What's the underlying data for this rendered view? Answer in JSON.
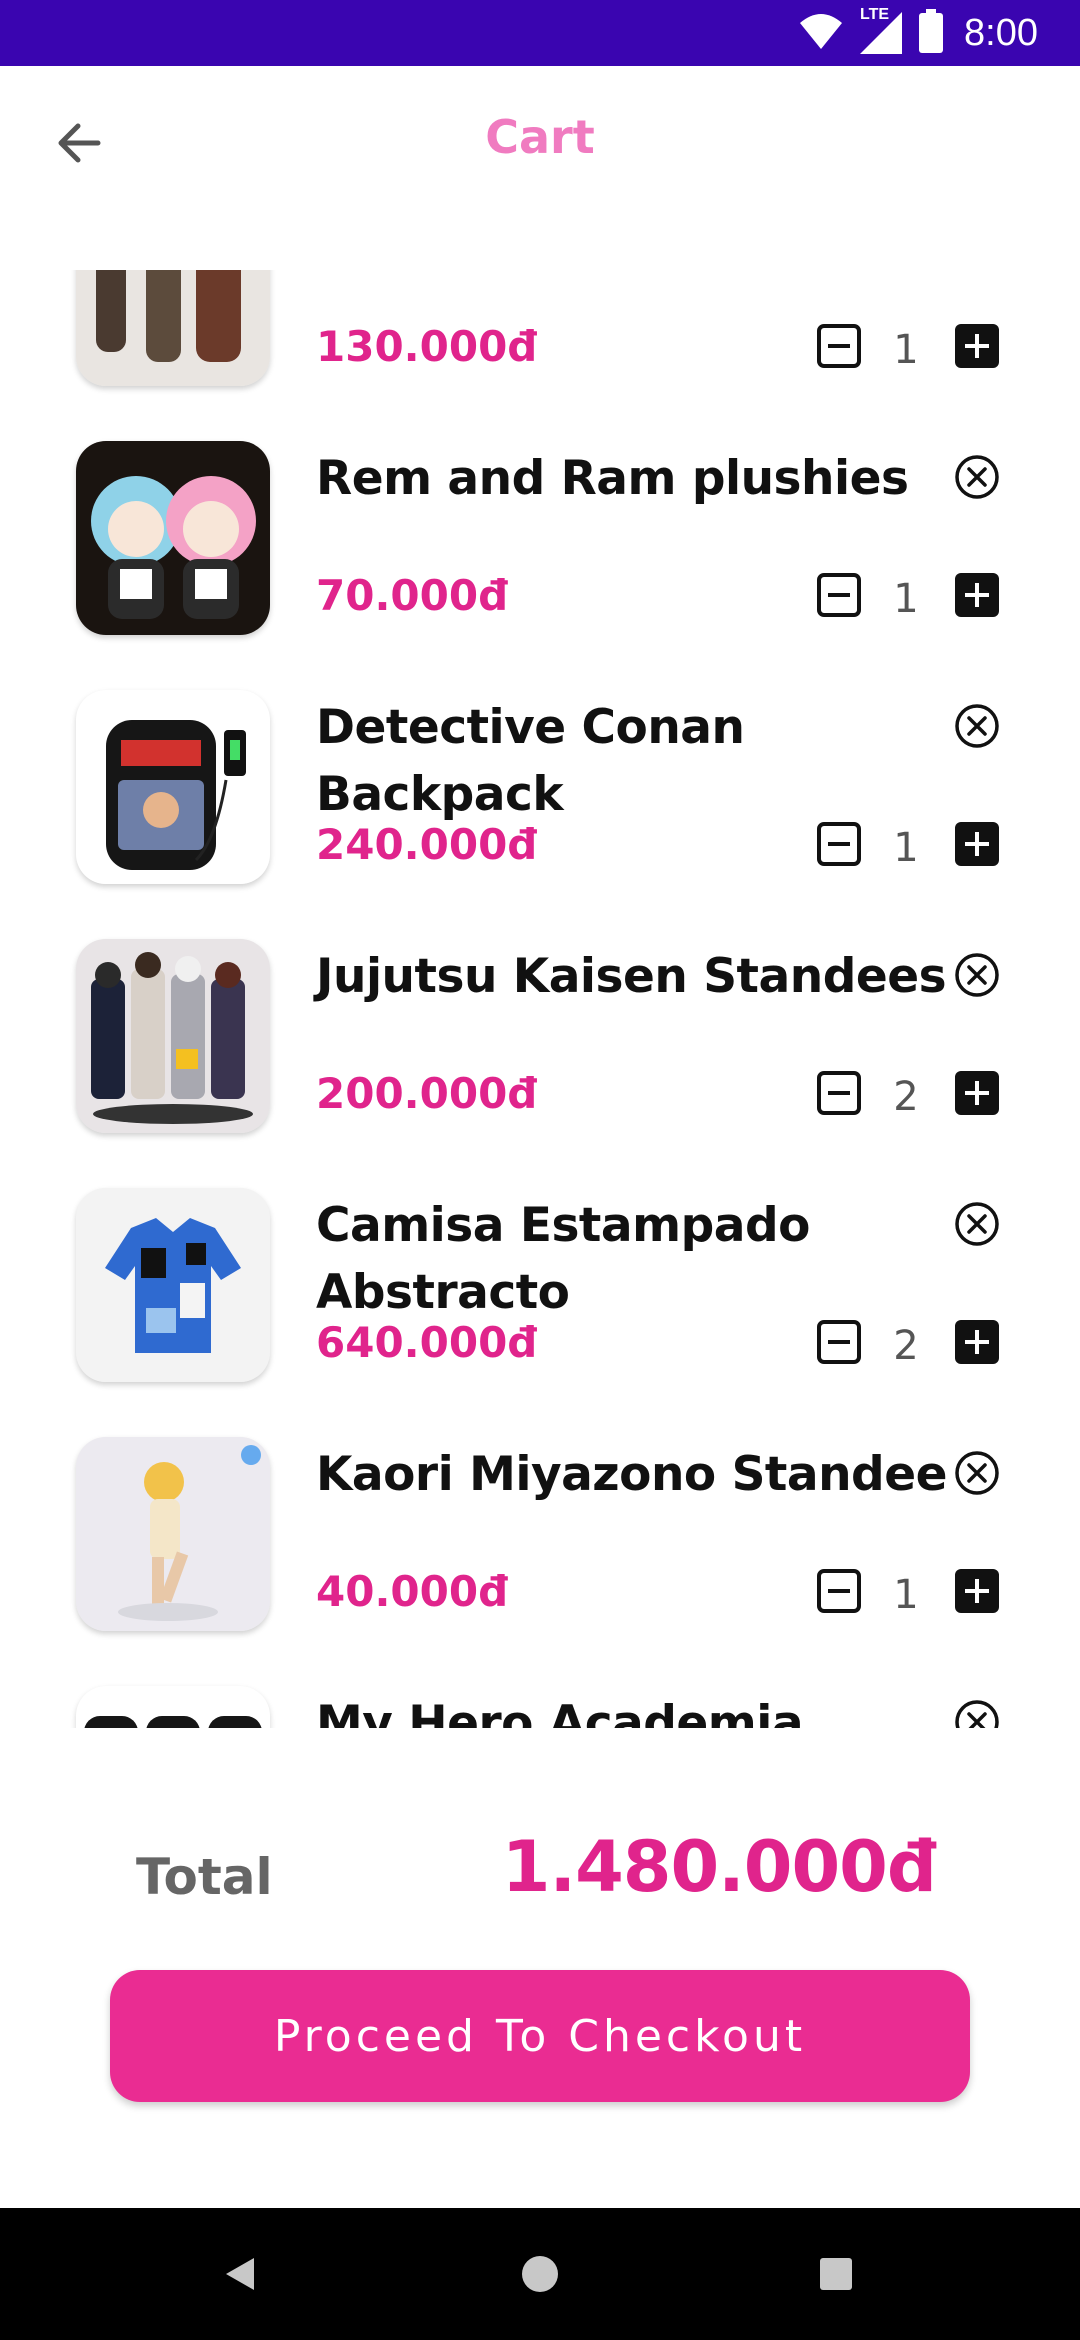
{
  "status_bar": {
    "time": "8:00",
    "network": "LTE",
    "colors": {
      "background": "#3a05b0"
    },
    "icons": [
      "wifi-icon",
      "signal-icon",
      "battery-icon"
    ]
  },
  "header": {
    "title": "Cart",
    "back_icon": "arrow-left-icon",
    "title_color": "#f07bc0"
  },
  "cart": {
    "items": [
      {
        "name": "",
        "price": "130.000đ",
        "quantity": "1",
        "image_icon": "figures-image"
      },
      {
        "name": "Rem and Ram plushies",
        "price": "70.000đ",
        "quantity": "1",
        "image_icon": "plushies-image"
      },
      {
        "name": "Detective Conan Backpack",
        "price": "240.000đ",
        "quantity": "1",
        "image_icon": "backpack-image"
      },
      {
        "name": "Jujutsu Kaisen Standees",
        "price": "200.000đ",
        "quantity": "2",
        "image_icon": "standees-image"
      },
      {
        "name": "Camisa Estampado Abstracto",
        "price": "640.000đ",
        "quantity": "2",
        "image_icon": "shirt-image"
      },
      {
        "name": "Kaori Miyazono Standee",
        "price": "40.000đ",
        "quantity": "1",
        "image_icon": "standee-image"
      },
      {
        "name": "My Hero Academia Backpack",
        "price": "",
        "quantity": "",
        "image_icon": "backpacks-image"
      }
    ],
    "remove_icon": "close-circle-icon",
    "minus_icon": "minus-box-icon",
    "plus_icon": "plus-box-icon",
    "price_color": "#e0248c"
  },
  "summary": {
    "total_label": "Total",
    "total_value": "1.480.000đ"
  },
  "checkout": {
    "label": "Proceed To Checkout",
    "color": "#ea2c92"
  },
  "nav_bar": {
    "icons": [
      "back-triangle-icon",
      "home-circle-icon",
      "recents-square-icon"
    ]
  }
}
